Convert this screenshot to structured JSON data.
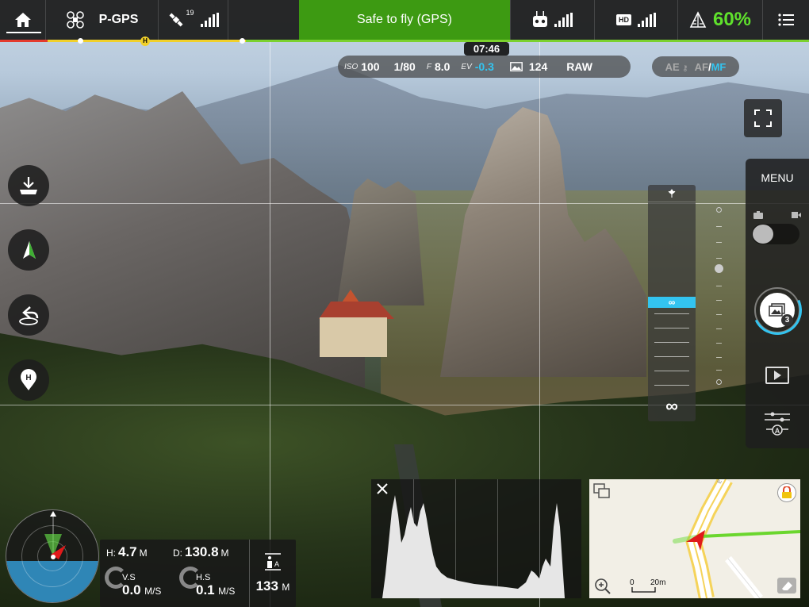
{
  "topbar": {
    "mode_label": "P-GPS",
    "satellite_count": "19",
    "status_text": "Safe to fly (GPS)",
    "hd_label": "HD",
    "battery_percent": "60%"
  },
  "flight_time": "07:46",
  "camera_params": {
    "iso_label": "ISO",
    "iso_value": "100",
    "shutter": "1/80",
    "aperture_label": "F",
    "aperture_value": "8.0",
    "ev_label": "EV",
    "ev_value": "-0.3",
    "photos_remaining": "124",
    "format": "RAW"
  },
  "focus_controls": {
    "ae_label": "AE",
    "af_label": "AF",
    "separator": "/",
    "mf_label": "MF"
  },
  "focus_slider": {
    "highlight_label": "∞",
    "bottom_label": "∞"
  },
  "right_panel": {
    "menu_label": "MENU",
    "burst_count": "3"
  },
  "telemetry": {
    "h_label": "H:",
    "h_value": "4.7",
    "h_unit": "M",
    "d_label": "D:",
    "d_value": "130.8",
    "d_unit": "M",
    "vs_label": "V.S",
    "vs_value": "0.0",
    "vs_unit": "M/S",
    "hs_label": "H.S",
    "hs_value": "0.1",
    "hs_unit": "M/S",
    "alt_limit_value": "133",
    "alt_limit_unit": "M"
  },
  "minimap": {
    "scale_start": "0",
    "scale_end": "20m"
  },
  "colors": {
    "status_green": "#3d9a12",
    "battery_green": "#5fe12c",
    "accent_blue": "#33c4f0",
    "aircraft_red": "#e01a1a"
  }
}
